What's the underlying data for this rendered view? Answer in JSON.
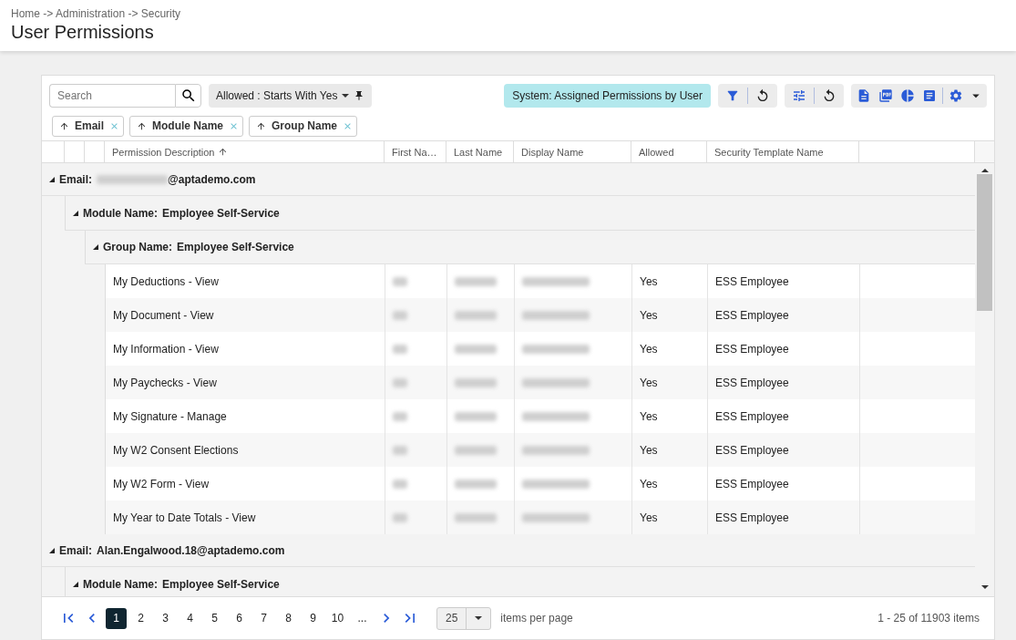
{
  "breadcrumb": "Home -> Administration -> Security",
  "title": "User Permissions",
  "search": {
    "placeholder": "Search"
  },
  "filter_chip": {
    "label": "Allowed : Starts With Yes"
  },
  "view_badge": "System: Assigned Permissions by User",
  "group_chips": [
    {
      "label": "Email"
    },
    {
      "label": "Module Name"
    },
    {
      "label": "Group Name"
    }
  ],
  "columns": [
    {
      "label": "Permission Description",
      "sorted": true
    },
    {
      "label": "First Na…",
      "sorted": false
    },
    {
      "label": "Last Name",
      "sorted": false
    },
    {
      "label": "Display Name",
      "sorted": false
    },
    {
      "label": "Allowed",
      "sorted": false
    },
    {
      "label": "Security Template Name",
      "sorted": false
    }
  ],
  "groups": [
    {
      "label": "Email:",
      "value": "@aptademo.com",
      "redacted": true,
      "expanded": true,
      "children": [
        {
          "label": "Module Name:",
          "value": "Employee Self-Service",
          "redacted": false,
          "expanded": true,
          "children": [
            {
              "label": "Group Name:",
              "value": "Employee Self-Service",
              "redacted": false,
              "expanded": true,
              "rows": [
                {
                  "description": "My Deductions - View",
                  "names_redacted": true,
                  "allowed": "Yes",
                  "template": "ESS Employee"
                },
                {
                  "description": "My Document - View",
                  "names_redacted": true,
                  "allowed": "Yes",
                  "template": "ESS Employee"
                },
                {
                  "description": "My Information - View",
                  "names_redacted": true,
                  "allowed": "Yes",
                  "template": "ESS Employee"
                },
                {
                  "description": "My Paychecks - View",
                  "names_redacted": true,
                  "allowed": "Yes",
                  "template": "ESS Employee"
                },
                {
                  "description": "My Signature - Manage",
                  "names_redacted": true,
                  "allowed": "Yes",
                  "template": "ESS Employee"
                },
                {
                  "description": "My W2 Consent Elections",
                  "names_redacted": true,
                  "allowed": "Yes",
                  "template": "ESS Employee"
                },
                {
                  "description": "My W2 Form - View",
                  "names_redacted": true,
                  "allowed": "Yes",
                  "template": "ESS Employee"
                },
                {
                  "description": "My Year to Date Totals - View",
                  "names_redacted": true,
                  "allowed": "Yes",
                  "template": "ESS Employee"
                }
              ]
            }
          ]
        }
      ]
    },
    {
      "label": "Email:",
      "value": "Alan.Engalwood.18@aptademo.com",
      "redacted": false,
      "expanded": true,
      "children": [
        {
          "label": "Module Name:",
          "value": "Employee Self-Service",
          "redacted": false,
          "expanded": true
        }
      ]
    }
  ],
  "pager": {
    "pages": [
      {
        "label": "1",
        "selected": true
      },
      {
        "label": "2",
        "selected": false
      },
      {
        "label": "3",
        "selected": false
      },
      {
        "label": "4",
        "selected": false
      },
      {
        "label": "5",
        "selected": false
      },
      {
        "label": "6",
        "selected": false
      },
      {
        "label": "7",
        "selected": false
      },
      {
        "label": "8",
        "selected": false
      },
      {
        "label": "9",
        "selected": false
      },
      {
        "label": "10",
        "selected": false
      },
      {
        "label": "...",
        "selected": false
      }
    ],
    "page_size": "25",
    "page_size_label": "items per page",
    "summary": "1 - 25 of 11903 items"
  }
}
